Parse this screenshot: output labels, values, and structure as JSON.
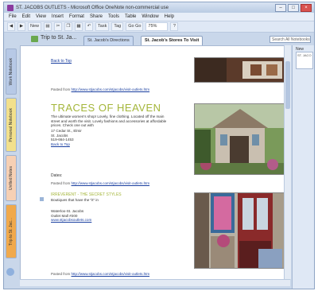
{
  "window": {
    "title": "ST. JACOBS OUTLETS - Microsoft Office OneNote non-commercial use"
  },
  "menu": {
    "items": [
      "File",
      "Edit",
      "View",
      "Insert",
      "Format",
      "Share",
      "Tools",
      "Table",
      "Window",
      "Help"
    ]
  },
  "toolbar": {
    "new_label": "New",
    "task_label": "Task",
    "tag_label": "Tag",
    "goto_label": "Go Go",
    "zoom": "75%"
  },
  "notebook": {
    "name": "Trip to St. Ja..."
  },
  "tabs": [
    {
      "label": "St. Jacob's Directions"
    },
    {
      "label": "St. Jacob's Stores To Visit"
    }
  ],
  "search": {
    "placeholder": "Search All Notebooks"
  },
  "sidebar": {
    "notebooks": [
      "Work Notebook",
      "Personal Notebook",
      "Unfiled Notes",
      "Trip to St. Jac..."
    ]
  },
  "page": {
    "back_link": "Back to Top",
    "pasted_from_label": "Pasted from",
    "pasted_from_url_1": "http://www.stjacobs.com/stjacobs/visit-outlets.htm",
    "heading": "TRACES OF HEAVEN",
    "description": "The ultimate women's shop! Lovely, fine clothing. Located off the main street and worth the visit. Lovely fashions and accessories at affordable prices. Check one out with",
    "address": [
      "17 Cedar St., Elmir",
      "St. Jacobs",
      "519-664-1453"
    ],
    "address_link": "Back to Top",
    "blank_line": "Dates:",
    "subheading": "IRREVERENT - THE SECRET STYLES",
    "description_2": "Boutiques that have the \"it\" in",
    "address_2": [
      "Waterloo-St. Jacobs",
      "Outlet Mall #200"
    ],
    "address_2_link": "www.stjacobsoutlets.com",
    "pasted_from_url_2": "http://www.stjacobs.com/stjacobs/visit-outlets.htm",
    "pasted_from_url_3": "http://www.stjacobs.com/stjacobs/visit-outlets.htm"
  },
  "right_pane": {
    "new_page": "New",
    "page_card": "ST. JACO"
  },
  "colors": {
    "heading": "#a4b63a",
    "link": "#1a3fa0",
    "chrome": "#c9d7ea"
  }
}
